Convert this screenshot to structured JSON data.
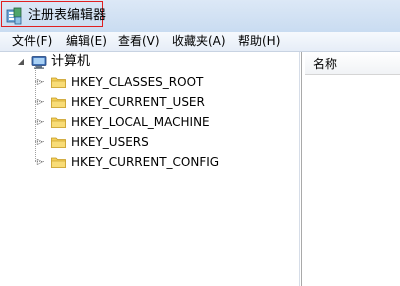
{
  "window": {
    "title": "注册表编辑器",
    "icon": "regedit-icon"
  },
  "menu": [
    {
      "label": "文件(F)"
    },
    {
      "label": "编辑(E)"
    },
    {
      "label": "查看(V)"
    },
    {
      "label": "收藏夹(A)"
    },
    {
      "label": "帮助(H)"
    }
  ],
  "tree": {
    "root": {
      "label": "计算机",
      "icon": "computer-icon",
      "expanded": true
    },
    "children": [
      {
        "label": "HKEY_CLASSES_ROOT",
        "icon": "folder-icon"
      },
      {
        "label": "HKEY_CURRENT_USER",
        "icon": "folder-icon"
      },
      {
        "label": "HKEY_LOCAL_MACHINE",
        "icon": "folder-icon"
      },
      {
        "label": "HKEY_USERS",
        "icon": "folder-icon"
      },
      {
        "label": "HKEY_CURRENT_CONFIG",
        "icon": "folder-icon"
      }
    ]
  },
  "list": {
    "columns": [
      {
        "label": "名称"
      }
    ]
  },
  "colors": {
    "highlight_border": "#e02020",
    "folder_yellow": "#f3cf5a"
  }
}
